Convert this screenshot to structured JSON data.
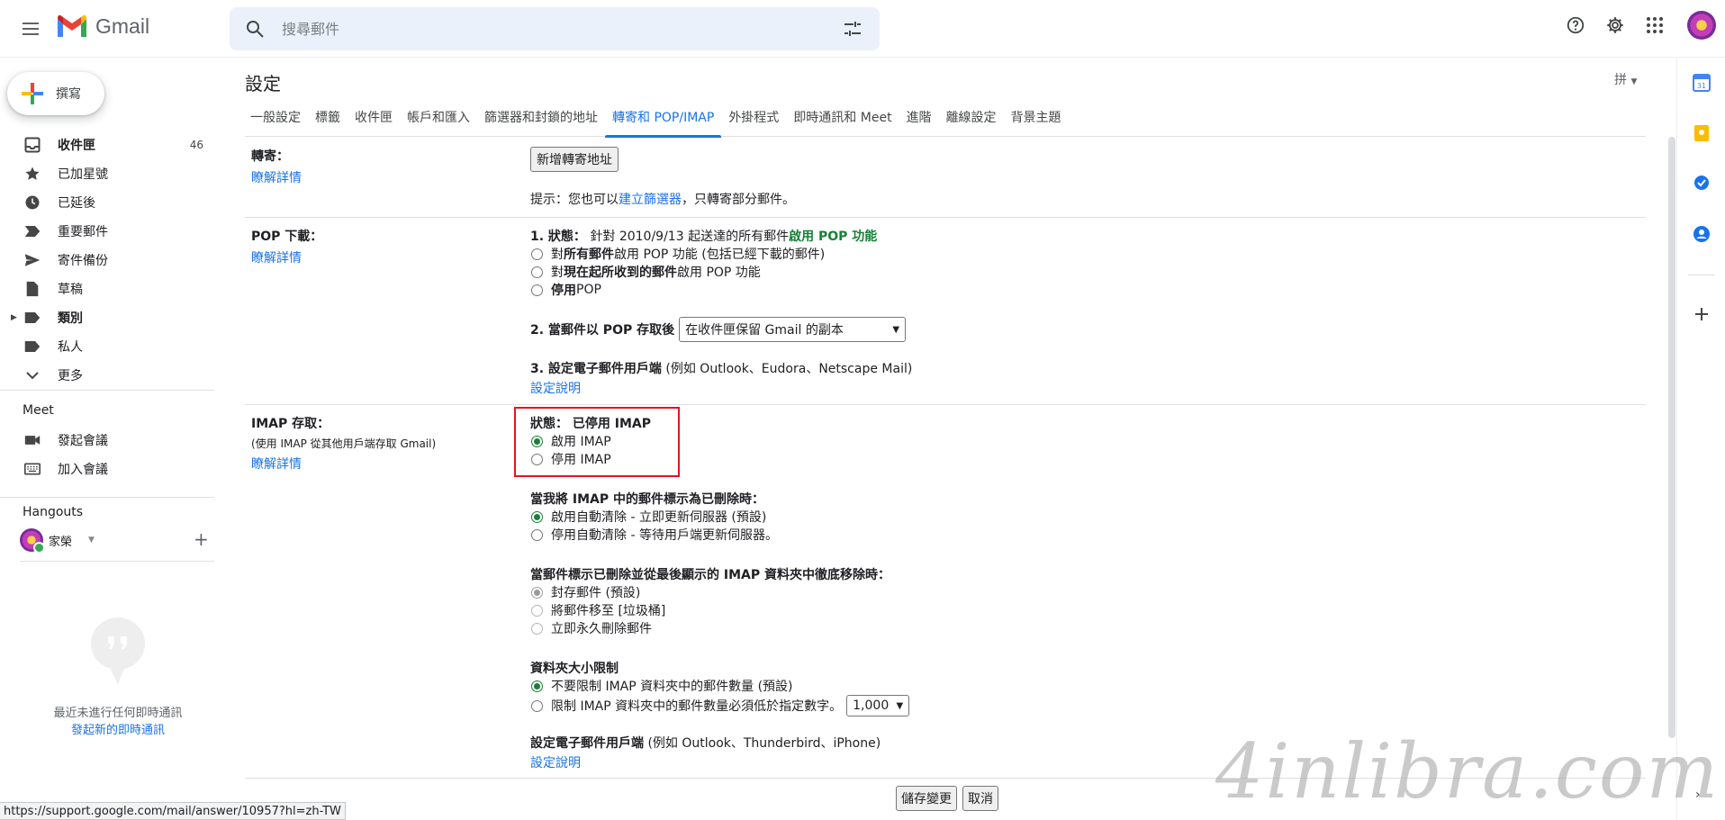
{
  "header": {
    "app_name": "Gmail",
    "search_placeholder": "搜尋郵件"
  },
  "compose": {
    "label": "撰寫"
  },
  "sidebar": {
    "items": [
      {
        "label": "收件匣",
        "count": "46",
        "icon": "inbox-icon",
        "bold": true
      },
      {
        "label": "已加星號",
        "icon": "star-icon"
      },
      {
        "label": "已延後",
        "icon": "clock-icon"
      },
      {
        "label": "重要郵件",
        "icon": "label-important-icon"
      },
      {
        "label": "寄件備份",
        "icon": "send-icon"
      },
      {
        "label": "草稿",
        "icon": "draft-icon"
      },
      {
        "label": "類別",
        "icon": "label-icon",
        "bold": true
      },
      {
        "label": "私人",
        "icon": "label-icon"
      },
      {
        "label": "更多",
        "icon": "chevron-down-icon"
      }
    ],
    "meet_title": "Meet",
    "meet_items": [
      {
        "label": "發起會議",
        "icon": "videocam-icon"
      },
      {
        "label": "加入會議",
        "icon": "keyboard-icon"
      }
    ],
    "hangouts_title": "Hangouts",
    "hangouts_user": "家榮",
    "empty_text": "最近未進行任何即時通訊",
    "empty_link": "發起新的即時通訊"
  },
  "settings": {
    "title": "設定",
    "input_tool": "拼",
    "tabs": [
      "一般設定",
      "標籤",
      "收件匣",
      "帳戶和匯入",
      "篩選器和封鎖的地址",
      "轉寄和 POP/IMAP",
      "外掛程式",
      "即時通訊和 Meet",
      "進階",
      "離線設定",
      "背景主題"
    ],
    "active_tab": "轉寄和 POP/IMAP",
    "forwarding": {
      "label": "轉寄：",
      "learn_more": "瞭解詳情",
      "add_button": "新增轉寄地址",
      "tip_prefix": "提示：您也可以",
      "tip_link": "建立篩選器",
      "tip_suffix": "，只轉寄部分郵件。"
    },
    "pop": {
      "label": "POP 下載：",
      "learn_more": "瞭解詳情",
      "status_prefix": "1. 狀態：",
      "status_text": "針對 2010/9/13 起送達的所有郵件",
      "status_highlight": "啟用 POP 功能",
      "opt1_pre": "對",
      "opt1_bold": "所有郵件",
      "opt1_post": "啟用 POP 功能 (包括已經下載的郵件)",
      "opt2_pre": "對",
      "opt2_bold": "現在起所收到的郵件",
      "opt2_post": "啟用 POP 功能",
      "opt3_bold": "停用",
      "opt3_post": " POP",
      "step2_label": "2. 當郵件以 POP 存取後",
      "step2_select": "在收件匣保留 Gmail 的副本",
      "step3_label": "3. 設定電子郵件用戶端",
      "step3_note": " (例如 Outlook、Eudora、Netscape Mail)",
      "setup_link": "設定說明"
    },
    "imap": {
      "label": "IMAP 存取：",
      "sub": "(使用 IMAP 從其他用戶端存取 Gmail)",
      "learn_more": "瞭解詳情",
      "status_label": "狀態：",
      "status_value": "已停用 IMAP",
      "enable": "啟用 IMAP",
      "disable": "停用 IMAP",
      "delete_title": "當我將 IMAP 中的郵件標示為已刪除時：",
      "auto_expunge_on": "啟用自動清除 - 立即更新伺服器 (預設)",
      "auto_expunge_off": "停用自動清除 - 等待用戶端更新伺服器。",
      "expunge_title": "當郵件標示已刪除並從最後顯示的 IMAP 資料夾中徹底移除時：",
      "archive": "封存郵件 (預設)",
      "trash": "將郵件移至 [垃圾桶]",
      "delete_forever": "立即永久刪除郵件",
      "folder_limit_title": "資料夾大小限制",
      "no_limit": "不要限制 IMAP 資料夾中的郵件數量 (預設)",
      "limit": "限制 IMAP 資料夾中的郵件數量必須低於指定數字。",
      "limit_value": "1,000",
      "client_label": "設定電子郵件用戶端",
      "client_note": " (例如 Outlook、Thunderbird、iPhone)",
      "setup_link": "設定說明"
    },
    "save_button": "儲存變更",
    "cancel_button": "取消"
  },
  "status_url": "https://support.google.com/mail/answer/10957?hl=zh-TW",
  "watermark": "4inlibra.com",
  "colors": {
    "accent": "#1a73e8",
    "highlight_box": "#e0161e",
    "pop_on": "#188038"
  }
}
